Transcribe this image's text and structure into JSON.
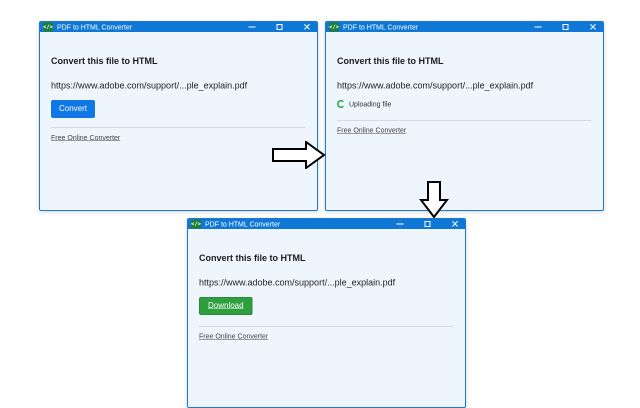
{
  "app": {
    "title": "PDF to HTML Converter",
    "icon_glyph": "</>",
    "icon_name": "code-icon"
  },
  "window_controls": {
    "minimize": "minimize-icon",
    "maximize": "maximize-icon",
    "close": "close-icon",
    "close_glyph": "✕"
  },
  "colors": {
    "titlebar": "#0f78d7",
    "window_background": "#eef5fd",
    "convert_button": "#0f78e6",
    "download_button": "#2f9e3e",
    "spinner": "#2fa84f"
  },
  "screens": [
    {
      "heading": "Convert this file to HTML",
      "file_url": "https://www.adobe.com/support/...ple_explain.pdf",
      "action_label": "Convert",
      "footer_link": "Free Online Converter"
    },
    {
      "heading": "Convert this file to HTML",
      "file_url": "https://www.adobe.com/support/...ple_explain.pdf",
      "status_text": "Uploading file",
      "footer_link": "Free Online Converter"
    },
    {
      "heading": "Convert this file to HTML",
      "file_url": "https://www.adobe.com/support/...ple_explain.pdf",
      "action_label": "Download",
      "footer_link": "Free Online Converter"
    }
  ],
  "flow_arrows": [
    "arrow-right-icon",
    "arrow-down-icon"
  ]
}
